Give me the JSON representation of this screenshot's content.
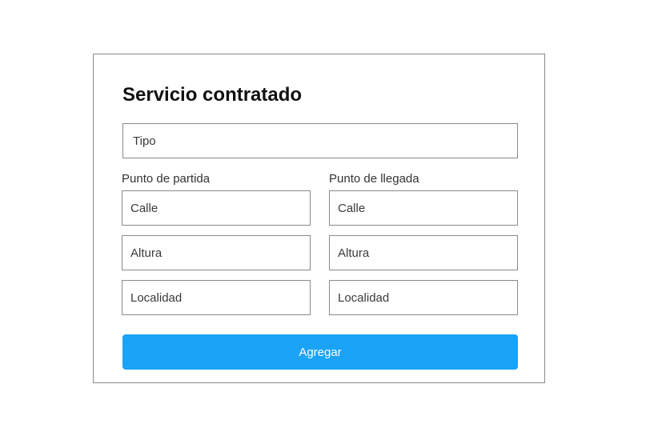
{
  "form": {
    "title": "Servicio contratado",
    "tipo_placeholder": "Tipo",
    "origin": {
      "label": "Punto de partida",
      "calle_placeholder": "Calle",
      "altura_placeholder": "Altura",
      "localidad_placeholder": "Localidad"
    },
    "destination": {
      "label": "Punto de llegada",
      "calle_placeholder": "Calle",
      "altura_placeholder": "Altura",
      "localidad_placeholder": "Localidad"
    },
    "submit_label": "Agregar"
  },
  "colors": {
    "accent": "#1aa3f7",
    "border": "#8a8a8a",
    "text": "#333333",
    "title": "#111111"
  }
}
